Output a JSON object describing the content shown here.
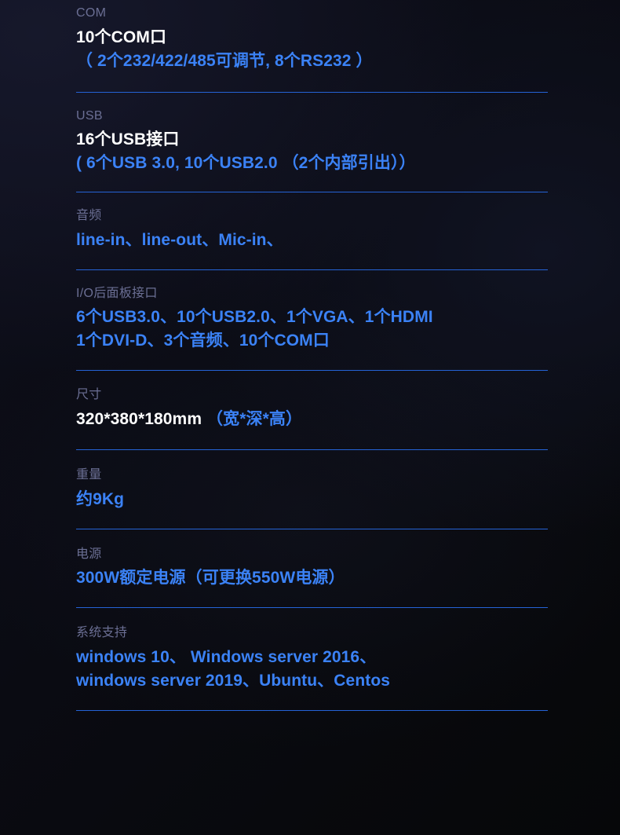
{
  "page": {
    "background_top_left": "#0e0f1c",
    "background_bottom_right": "#08090d",
    "label_color": "#6b6f94",
    "accent_blue": "#3b82f6",
    "divider_color": "#2563d6",
    "heading_white": "#ffffff"
  },
  "specs": [
    {
      "label": "COM",
      "lines": [
        {
          "text": "10个COM口",
          "color": "white"
        },
        {
          "text": "（ 2个232/422/485可调节, 8个RS232 ）",
          "color": "blue"
        }
      ]
    },
    {
      "label": "USB",
      "lines": [
        {
          "text": "16个USB接口",
          "color": "white"
        },
        {
          "text": "( 6个USB 3.0, 10个USB2.0 （2个内部引出））",
          "color": "blue"
        }
      ]
    },
    {
      "label": "音频",
      "lines": [
        {
          "text": "line-in、line-out、Mic-in、",
          "color": "blue"
        }
      ]
    },
    {
      "label": "I/O后面板接口",
      "lines": [
        {
          "text": "6个USB3.0、10个USB2.0、1个VGA、1个HDMI",
          "color": "blue"
        },
        {
          "text": "1个DVI-D、3个音频、10个COM口",
          "color": "blue"
        }
      ]
    },
    {
      "label": "尺寸",
      "lines": [
        {
          "text": "320*380*180mm ",
          "color": "white",
          "suffix": "（宽*深*高）",
          "suffix_color": "blue"
        }
      ]
    },
    {
      "label": "重量",
      "lines": [
        {
          "text": "约9Kg",
          "color": "blue"
        }
      ]
    },
    {
      "label": "电源",
      "lines": [
        {
          "text": "300W额定电源（可更换550W电源）",
          "color": "blue"
        }
      ]
    },
    {
      "label": "系统支持",
      "lines": [
        {
          "text": "windows 10、 Windows server 2016、",
          "color": "blue"
        },
        {
          "text": "windows server 2019、Ubuntu、Centos",
          "color": "blue"
        }
      ]
    }
  ]
}
